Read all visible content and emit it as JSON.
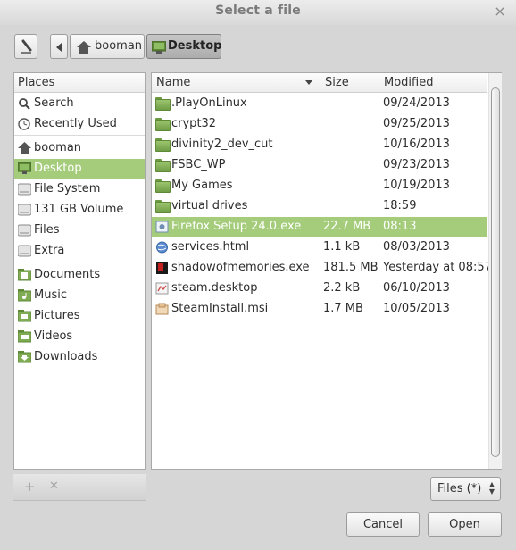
{
  "window": {
    "title": "Select a file"
  },
  "pathbar": {
    "crumbs": [
      {
        "label": "booman"
      },
      {
        "label": "Desktop"
      }
    ]
  },
  "places": {
    "header": "Places",
    "items": [
      {
        "label": "Search",
        "icon": "search-icon"
      },
      {
        "label": "Recently Used",
        "icon": "clock-icon"
      },
      {
        "label": "booman",
        "icon": "home-icon"
      },
      {
        "label": "Desktop",
        "icon": "desktop-icon",
        "selected": true
      },
      {
        "label": "File System",
        "icon": "drive-icon"
      },
      {
        "label": "131 GB Volume",
        "icon": "drive-icon"
      },
      {
        "label": "Files",
        "icon": "drive-icon"
      },
      {
        "label": "Extra",
        "icon": "drive-icon"
      },
      {
        "label": "Documents",
        "icon": "folder-icon"
      },
      {
        "label": "Music",
        "icon": "music-folder-icon"
      },
      {
        "label": "Pictures",
        "icon": "pictures-folder-icon"
      },
      {
        "label": "Videos",
        "icon": "videos-folder-icon"
      },
      {
        "label": "Downloads",
        "icon": "downloads-folder-icon"
      }
    ],
    "add_glyph": "+",
    "remove_glyph": "✕"
  },
  "files": {
    "columns": {
      "name": "Name",
      "size": "Size",
      "modified": "Modified"
    },
    "rows": [
      {
        "name": ".PlayOnLinux",
        "size": "",
        "modified": "09/24/2013",
        "icon": "folder-icon"
      },
      {
        "name": "crypt32",
        "size": "",
        "modified": "09/25/2013",
        "icon": "folder-icon"
      },
      {
        "name": "divinity2_dev_cut",
        "size": "",
        "modified": "10/16/2013",
        "icon": "folder-icon"
      },
      {
        "name": "FSBC_WP",
        "size": "",
        "modified": "09/23/2013",
        "icon": "folder-icon"
      },
      {
        "name": "My Games",
        "size": "",
        "modified": "10/19/2013",
        "icon": "folder-icon"
      },
      {
        "name": "virtual drives",
        "size": "",
        "modified": "18:59",
        "icon": "folder-icon"
      },
      {
        "name": "Firefox Setup 24.0.exe",
        "size": "22.7 MB",
        "modified": "08:13",
        "icon": "exe-icon",
        "selected": true
      },
      {
        "name": "services.html",
        "size": "1.1 kB",
        "modified": "08/03/2013",
        "icon": "html-icon"
      },
      {
        "name": "shadowofmemories.exe",
        "size": "181.5 MB",
        "modified": "Yesterday at 08:57",
        "icon": "exe-icon"
      },
      {
        "name": "steam.desktop",
        "size": "2.2 kB",
        "modified": "06/10/2013",
        "icon": "desktop-file-icon"
      },
      {
        "name": "SteamInstall.msi",
        "size": "1.7 MB",
        "modified": "10/05/2013",
        "icon": "msi-icon"
      }
    ]
  },
  "filter": {
    "label": "Files (*)"
  },
  "buttons": {
    "cancel": "Cancel",
    "open": "Open"
  },
  "colors": {
    "selection": "#a4cc7b",
    "folder": "#7fab52"
  }
}
